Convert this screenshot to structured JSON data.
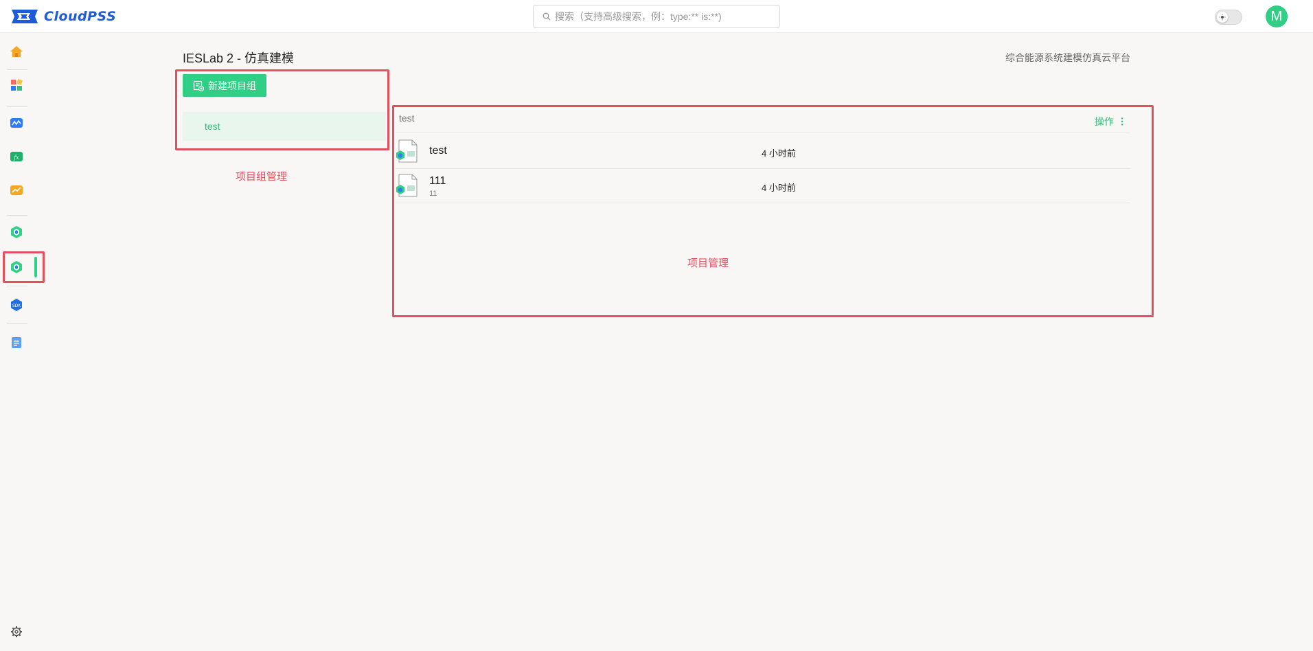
{
  "app": {
    "logo_text": "CloudPSS"
  },
  "search": {
    "placeholder": "搜索（支持高级搜索，例：type:** is:**)"
  },
  "user": {
    "avatar_letter": "M"
  },
  "sidebar": {
    "items": [
      {
        "name": "home",
        "icon": "home-icon"
      },
      {
        "name": "apps",
        "icon": "apps-grid-icon"
      },
      {
        "name": "emt",
        "icon": "waveform-app-icon"
      },
      {
        "name": "function",
        "icon": "fx-app-icon"
      },
      {
        "name": "analysis",
        "icon": "chart-app-icon"
      },
      {
        "name": "ieslab-modeling",
        "icon": "ieslab-hex-icon",
        "active": true
      },
      {
        "name": "ieslab-other",
        "icon": "ieslab-hex-icon-2"
      },
      {
        "name": "sdk",
        "icon": "sdk-app-icon"
      },
      {
        "name": "docs",
        "icon": "document-app-icon"
      }
    ],
    "settings_icon": "gear-icon"
  },
  "page": {
    "title": "IESLab 2 - 仿真建模",
    "subtitle": "综合能源系统建模仿真云平台"
  },
  "groups": {
    "new_button_label": "新建项目组",
    "items": [
      {
        "label": "test",
        "selected": true
      }
    ],
    "annotation": "项目组管理"
  },
  "projects": {
    "group_name": "test",
    "actions_label": "操作",
    "rows": [
      {
        "name": "test",
        "description": "",
        "updated": "4 小时前"
      },
      {
        "name": "111",
        "description": "11",
        "updated": "4 小时前"
      }
    ],
    "annotation": "项目管理"
  },
  "colors": {
    "accent": "#2fcf85",
    "annotation_red": "#e2505d",
    "selected_bg": "#e8f6ee",
    "page_bg": "#f8f7f5"
  }
}
